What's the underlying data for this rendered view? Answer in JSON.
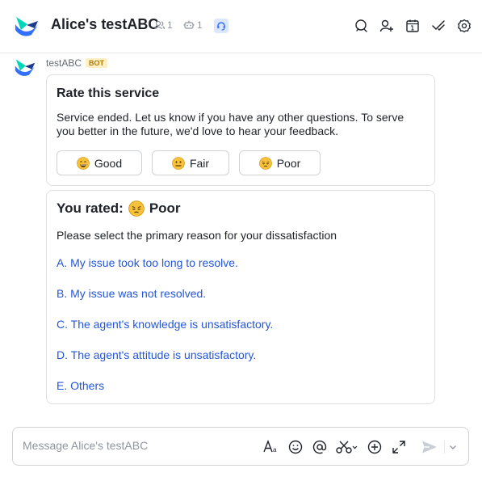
{
  "header": {
    "title": "Alice's testABC",
    "member_count": "1",
    "bot_count": "1"
  },
  "message": {
    "sender": "testABC",
    "bot_tag": "BOT"
  },
  "rating_card": {
    "title": "Rate this service",
    "text": "Service ended. Let us know if you have any other questions. To serve you better in the future, we'd love to hear your feedback.",
    "buttons": [
      {
        "label": "Good",
        "emoji": "grinning"
      },
      {
        "label": "Fair",
        "emoji": "neutral"
      },
      {
        "label": "Poor",
        "emoji": "pensive"
      }
    ]
  },
  "reason_card": {
    "title_prefix": "You rated:",
    "rating": "Poor",
    "prompt": "Please select the primary reason for your dissatisfaction",
    "options": [
      "A. My issue took too long to resolve.",
      "B. My issue was not resolved.",
      "C. The agent's knowledge is unsatisfactory.",
      "D. The agent's attitude is unsatisfactory.",
      "E. Others"
    ]
  },
  "composer": {
    "placeholder": "Message Alice's testABC"
  },
  "colors": {
    "link": "#2456d8",
    "brand_blue": "#3370ff",
    "brand_teal": "#00d6b9",
    "emoji_yellow": "#f7c23b"
  }
}
